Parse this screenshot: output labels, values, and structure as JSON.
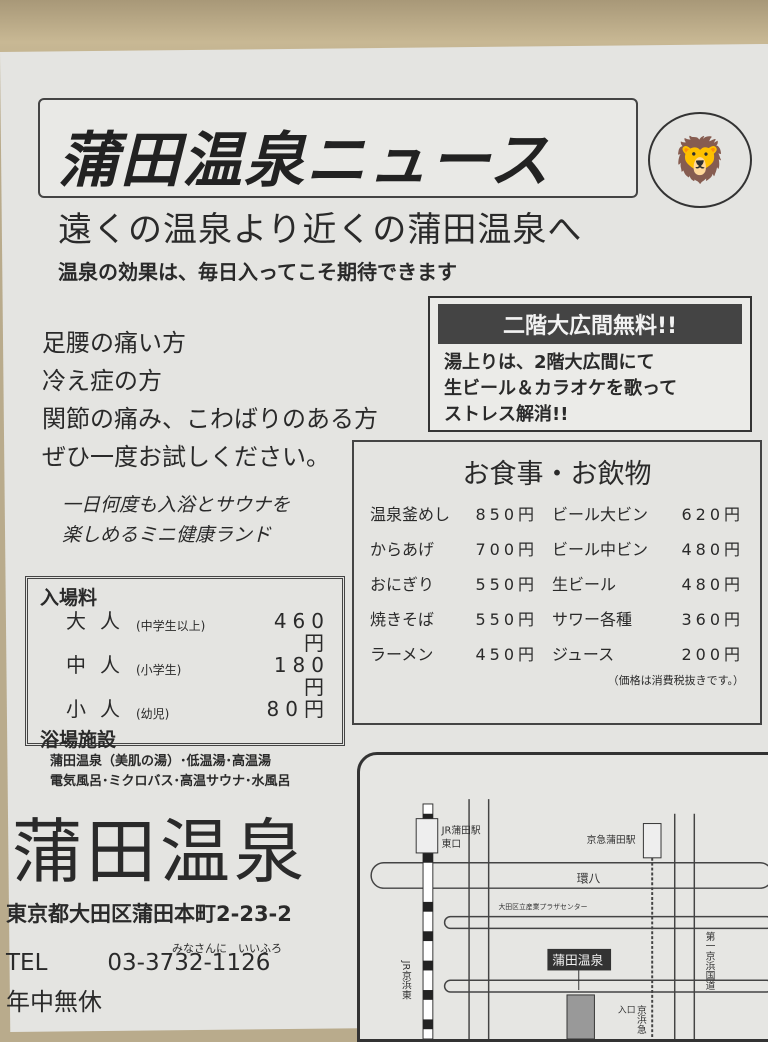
{
  "header": {
    "title": "蒲田温泉ニュース",
    "mascot_icon": "lion-mascot-icon"
  },
  "tagline": "遠くの温泉より近くの蒲田温泉へ",
  "subtagline": "温泉の効果は、毎日入ってこそ期待できます",
  "free_hall": {
    "title": "二階大広間無料!!",
    "lines": [
      "湯上りは、2階大広間にて",
      "生ビール＆カラオケを歌って",
      "ストレス解消!!"
    ]
  },
  "recommend": [
    "足腰の痛い方",
    "冷え症の方",
    "関節の痛み、こわばりのある方",
    "ぜひ一度お試しください。"
  ],
  "mini": [
    "一日何度も入浴とサウナを",
    "楽しめるミニ健康ランド"
  ],
  "admission": {
    "title": "入場料",
    "rows": [
      {
        "name": "大人",
        "sub": "(中学生以上)",
        "price": "460円"
      },
      {
        "name": "中人",
        "sub": "(小学生)",
        "price": "180円"
      },
      {
        "name": "小人",
        "sub": "(幼児)",
        "price": "80円"
      }
    ],
    "facilities_title": "浴場施設",
    "facilities": [
      "蒲田温泉（美肌の湯）･低温湯･高温湯",
      "電気風呂･ミクロバス･高温サウナ･水風呂"
    ]
  },
  "menu": {
    "title": "お食事・お飲物",
    "rows": [
      {
        "food": "温泉釜めし",
        "food_price": "850円",
        "drink": "ビール大ビン",
        "drink_price": "620円"
      },
      {
        "food": "からあげ",
        "food_price": "700円",
        "drink": "ビール中ビン",
        "drink_price": "480円"
      },
      {
        "food": "おにぎり",
        "food_price": "550円",
        "drink": "生ビール",
        "drink_price": "480円"
      },
      {
        "food": "焼きそば",
        "food_price": "550円",
        "drink": "サワー各種",
        "drink_price": "360円"
      },
      {
        "food": "ラーメン",
        "food_price": "450円",
        "drink": "ジュース",
        "drink_price": "200円"
      }
    ],
    "note": "（価格は消費税抜きです。）"
  },
  "store": {
    "name": "蒲田温泉",
    "address": "東京都大田区蒲田本町2-23-2",
    "tel_label": "TEL",
    "tel": "03-3732-1126",
    "tel_ruby": "みなさんに　いいふろ",
    "closed": "年中無休"
  },
  "map": {
    "jr_station": "JR蒲田駅",
    "jr_exit": "東口",
    "keikyu_station": "京急蒲田駅",
    "road": "環八",
    "route1": "第一京浜国道",
    "jr_line": "JR京浜東",
    "keikyu_line": "京浜急",
    "marker": "蒲田温泉",
    "entrance": "入口",
    "center": "大田区立産業プラザセンター"
  }
}
